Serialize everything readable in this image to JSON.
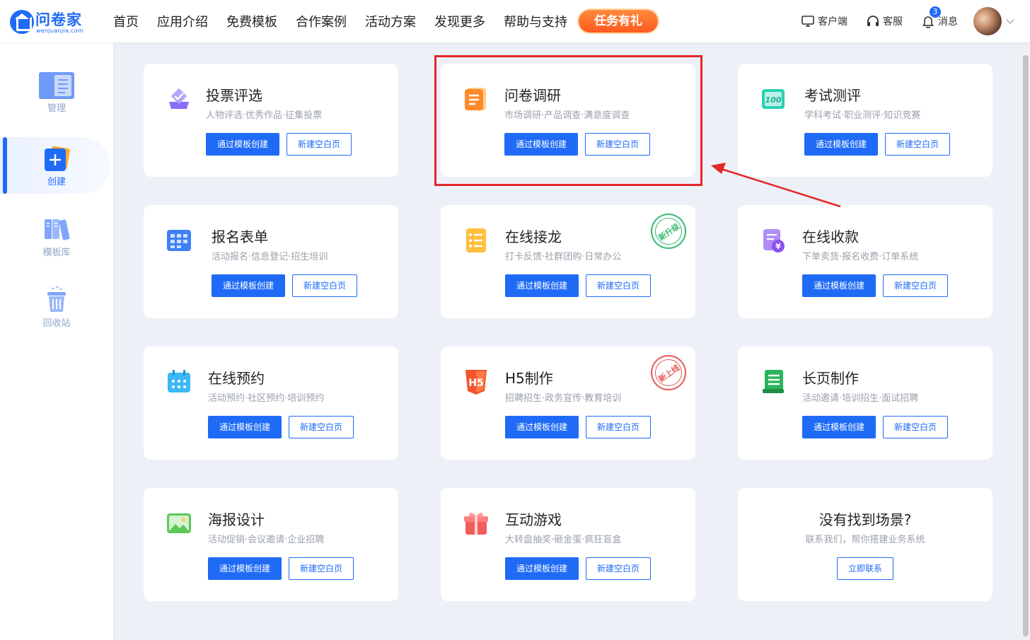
{
  "header": {
    "logo": {
      "name": "问卷家",
      "url": "wenjuanjia.com"
    },
    "nav": [
      "首页",
      "应用介绍",
      "免费模板",
      "合作案例",
      "活动方案",
      "发现更多",
      "帮助与支持"
    ],
    "promo": "任务有礼",
    "right": {
      "client": "客户端",
      "service": "客服",
      "messages": "消息",
      "message_count": "3"
    }
  },
  "sidebar": {
    "items": [
      {
        "label": "管理",
        "icon": "document-list-icon"
      },
      {
        "label": "创建",
        "icon": "plus-icon",
        "active": true
      },
      {
        "label": "模板库",
        "icon": "books-icon"
      },
      {
        "label": "回收站",
        "icon": "trash-icon"
      }
    ]
  },
  "buttons": {
    "template_create": "通过模板创建",
    "new_blank": "新建空白页",
    "contact": "立即联系"
  },
  "cards": [
    {
      "title": "投票评选",
      "desc": "人物评选·优秀作品·征集投票",
      "icon": "vote-icon",
      "color": "#7b5cf5"
    },
    {
      "title": "问卷调研",
      "desc": "市场调研·产品调查·满意度调查",
      "icon": "questionnaire-icon",
      "color": "#ff8a2b"
    },
    {
      "title": "考试测评",
      "desc": "学科考试·职业测评·知识竞赛",
      "icon": "exam-icon",
      "color": "#2ccfb5"
    },
    {
      "title": "报名表单",
      "desc": "活动报名·信息登记·招生培训",
      "icon": "form-grid-icon",
      "color": "#3e7ff7"
    },
    {
      "title": "在线接龙",
      "desc": "打卡反馈·社群团购·日常办公",
      "icon": "relay-list-icon",
      "color": "#ffb42b",
      "stamp": "新升级"
    },
    {
      "title": "在线收款",
      "desc": "下单卖货·报名收费·订单系统",
      "icon": "payment-icon",
      "color": "#9b5cf0"
    },
    {
      "title": "在线预约",
      "desc": "活动预约·社区预约·培训预约",
      "icon": "calendar-icon",
      "color": "#3bb8f5"
    },
    {
      "title": "H5制作",
      "desc": "招聘招生·政务宣传·教育培训",
      "icon": "h5-icon",
      "color": "#f2552c",
      "stamp": "新上线"
    },
    {
      "title": "长页制作",
      "desc": "活动邀请·培训招生·面试招聘",
      "icon": "long-page-icon",
      "color": "#2bb55a"
    },
    {
      "title": "海报设计",
      "desc": "活动促销·会议邀请·企业招聘",
      "icon": "poster-image-icon",
      "color": "#5cc85a"
    },
    {
      "title": "互动游戏",
      "desc": "大转盘抽奖·砸金蛋·疯狂盲盒",
      "icon": "gift-icon",
      "color": "#f25c5c"
    }
  ],
  "contact_card": {
    "title": "没有找到场景?",
    "desc": "联系我们，帮你搭建业务系统"
  },
  "colors": {
    "accent": "#1f6bf5",
    "promo": "#ff6a22",
    "annotation": "#e5262a"
  }
}
